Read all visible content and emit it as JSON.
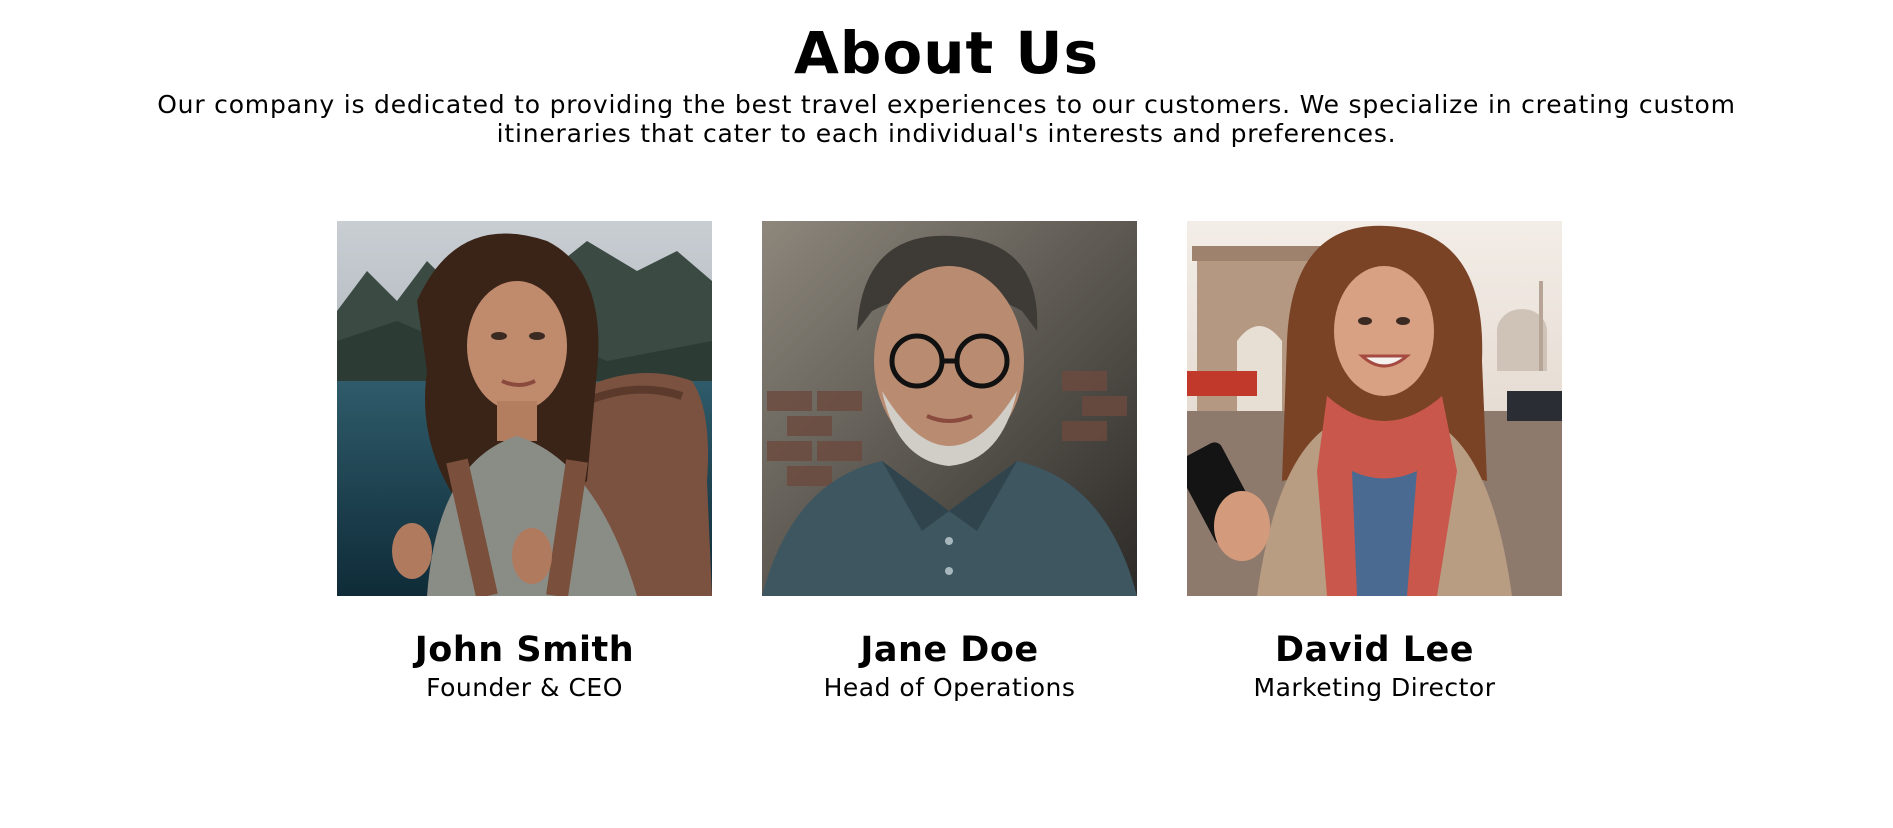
{
  "about": {
    "title": "About Us",
    "intro": "Our company is dedicated to providing the best travel experiences to our customers. We specialize in creating custom itineraries that cater to each individual's interests and preferences."
  },
  "team": [
    {
      "name": "John Smith",
      "role": "Founder & CEO",
      "photo": "portrait-woman-backpacker-coast"
    },
    {
      "name": "Jane Doe",
      "role": "Head of Operations",
      "photo": "portrait-man-glasses-brick-wall"
    },
    {
      "name": "David Lee",
      "role": "Marketing Director",
      "photo": "portrait-woman-phone-india-gate"
    }
  ]
}
